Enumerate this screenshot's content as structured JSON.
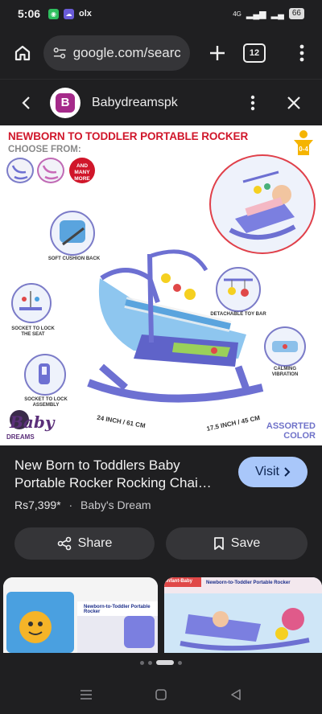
{
  "status_bar": {
    "time": "5:06",
    "network": "4G",
    "battery": "66"
  },
  "browser": {
    "url": "google.com/search",
    "tab_count": "12"
  },
  "viewer": {
    "site_name": "Babydreamspk",
    "site_logo_letter": "B"
  },
  "image": {
    "title": "NEWBORN TO TODDLER PORTABLE ROCKER",
    "choose_from": "CHOOSE FROM:",
    "age_badge": "0-4",
    "many_more": [
      "AND",
      "MANY",
      "MORE"
    ],
    "callouts": {
      "soft_cushion": "SOFT CUSHION BACK",
      "socket_seat": [
        "SOCKET TO LOCK",
        "THE SEAT"
      ],
      "socket_assembly": [
        "SOCKET TO LOCK",
        "ASSEMBLY"
      ],
      "toy_bar": "DETACHABLE TOY BAR",
      "vibration": [
        "CALMING",
        "VIBRATION"
      ]
    },
    "dim_width": "24 INCH / 61 CM",
    "dim_depth": "17.5 INCH / 45 CM",
    "assorted": [
      "ASSORTED",
      "COLOR"
    ],
    "brand_logo": [
      "Baby",
      "DREAMS"
    ]
  },
  "product": {
    "title": "New Born to Toddlers Baby Portable Rocker Rocking Chai…",
    "visit_label": "Visit",
    "price": "Rs7,399*",
    "separator": "·",
    "seller": "Baby's Dream",
    "share_label": "Share",
    "save_label": "Save"
  },
  "related": {
    "card1_box_label": "Newborn-to-Toddler Portable Rocker",
    "card2_box_label": "Newborn-to-Toddler Portable Rocker",
    "card2_brand": "Infant-Baby"
  },
  "colors": {
    "accent": "#a9c7fa",
    "title_red": "#d0162a",
    "rocker_blue": "#6d70d2"
  }
}
